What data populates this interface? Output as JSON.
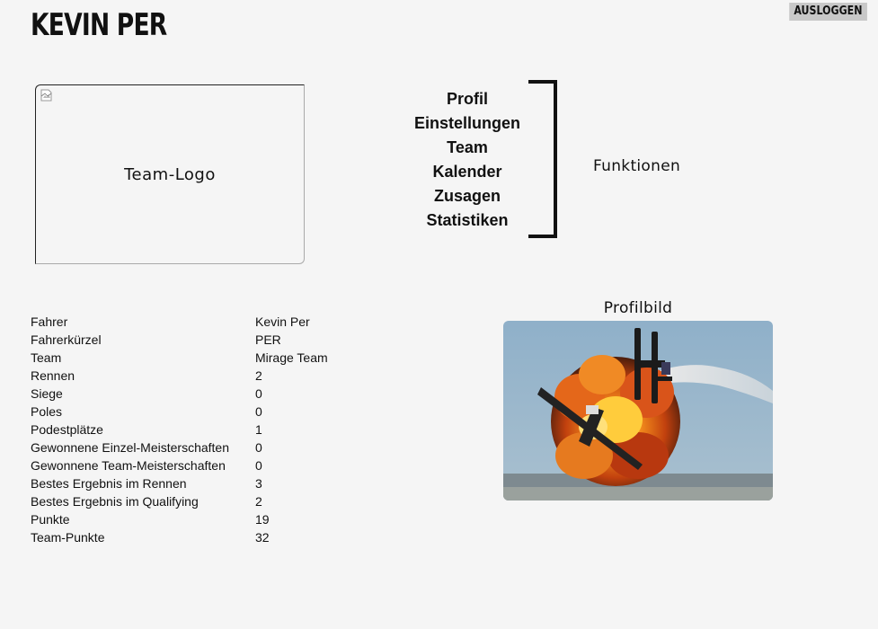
{
  "header": {
    "title": "Kevin Per",
    "logout_label": "AUSLOGGEN"
  },
  "team_logo": {
    "alt_text": "Team-Logo",
    "icon": "broken-image-icon"
  },
  "menu": {
    "items": [
      {
        "label": "Profil"
      },
      {
        "label": "Einstellungen"
      },
      {
        "label": "Team"
      },
      {
        "label": "Kalender"
      },
      {
        "label": "Zusagen"
      },
      {
        "label": "Statistiken"
      }
    ],
    "group_label": "Funktionen"
  },
  "stats": {
    "rows": [
      {
        "label": "Fahrer",
        "value": "Kevin Per"
      },
      {
        "label": "Fahrerkürzel",
        "value": "PER"
      },
      {
        "label": "Team",
        "value": "Mirage Team"
      },
      {
        "label": "Rennen",
        "value": "2"
      },
      {
        "label": "Siege",
        "value": "0"
      },
      {
        "label": "Poles",
        "value": "0"
      },
      {
        "label": "Podestplätze",
        "value": "1"
      },
      {
        "label": "Gewonnene Einzel-Meisterschaften",
        "value": "0"
      },
      {
        "label": "Gewonnene Team-Meisterschaften",
        "value": "0"
      },
      {
        "label": "Bestes Ergebnis im Rennen",
        "value": "3"
      },
      {
        "label": "Bestes Ergebnis im Qualifying",
        "value": "2"
      },
      {
        "label": "Punkte",
        "value": "19"
      },
      {
        "label": "Team-Punkte",
        "value": "32"
      }
    ]
  },
  "profile": {
    "label": "Profilbild"
  },
  "colors": {
    "background": "#f5f5f5",
    "text": "#111111",
    "button_bg": "#c8c8c8"
  }
}
